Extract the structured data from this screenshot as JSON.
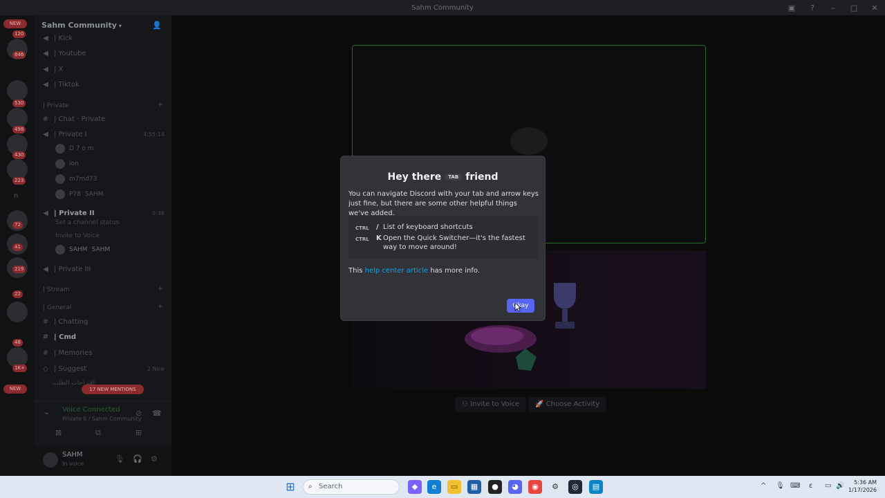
{
  "window": {
    "title": "Sahm Community"
  },
  "server_rail": {
    "top_badge": "NEW",
    "badges": [
      "120",
      "846",
      "530",
      "498",
      "430",
      "223",
      "72",
      "41",
      "219",
      "22",
      "48",
      "1K+"
    ],
    "bottom_badge": "NEW",
    "letter": "n"
  },
  "sidebar": {
    "server_name": "Sahm Community",
    "channels_top": [
      "| Kick",
      "| Youtube",
      "| X",
      "| Tiktok"
    ],
    "category_private": "| Private",
    "chat_private": "| Chat · Private",
    "private_i": "| Private I",
    "private_i_time": "4:55:14",
    "private_i_users": [
      "D 7 o m",
      "ion",
      "m7md73",
      "P78"
    ],
    "private_i_user4_tag": "SAHM",
    "private_ii": "| Private II",
    "private_ii_time": "9:46",
    "set_status": "Set a channel status",
    "invite_to_voice": "Invite to Voice",
    "private_ii_user": "SAHM",
    "private_ii_user_tag": "SAHM",
    "private_iii": "| Private III",
    "category_stream": "| Stream",
    "category_general": "| General",
    "text_channels": [
      "| Chatting",
      "| Cmd",
      "| Memories",
      "| Suggest"
    ],
    "suggest_new": "2 New",
    "arabic_channel": "اقتراحات الطلب",
    "new_mentions": "17 NEW MENTIONS"
  },
  "voice": {
    "status": "Voice Connected",
    "location": "Private II / Sahm Community"
  },
  "user": {
    "name": "SAHM",
    "status": "In voice"
  },
  "main": {
    "invite_button": "Invite to Voice",
    "activity_button": "Choose Activity"
  },
  "modal": {
    "title_pre": "Hey there",
    "title_key": "TAB",
    "title_post": "friend",
    "description": "You can navigate Discord with your tab and arrow keys just fine, but there are some other helpful things we've added.",
    "shortcuts": [
      {
        "key": "CTRL",
        "symbol": "/",
        "text": "List of keyboard shortcuts"
      },
      {
        "key": "CTRL",
        "symbol": "K",
        "text": "Open the Quick Switcher—it's the fastest way to move around!"
      }
    ],
    "footer_pre": "This",
    "footer_link": "help center article",
    "footer_post": "has more info.",
    "okay": "Okay"
  },
  "taskbar": {
    "search_placeholder": "Search",
    "time": "5:36 AM",
    "date": "1/17/2026"
  },
  "colors": {
    "accent": "#5865f2",
    "link": "#00a8fc",
    "stream_border": "#1f6b2a",
    "badge": "#8c2b2d"
  }
}
